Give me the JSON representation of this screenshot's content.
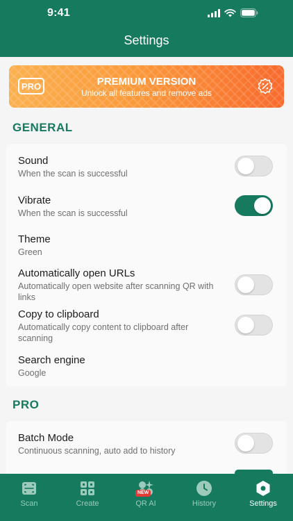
{
  "status_bar": {
    "time": "9:41"
  },
  "header": {
    "title": "Settings"
  },
  "premium": {
    "badge": "PRO",
    "title": "PREMIUM VERSION",
    "subtitle": "Unlock all features and remove ads"
  },
  "sections": {
    "general": "GENERAL",
    "pro": "PRO"
  },
  "general_items": [
    {
      "title": "Sound",
      "subtitle": "When the scan is successful",
      "toggle": "off"
    },
    {
      "title": "Vibrate",
      "subtitle": "When the scan is successful",
      "toggle": "on"
    },
    {
      "title": "Theme",
      "subtitle": "Green"
    },
    {
      "title": "Automatically open URLs",
      "subtitle": "Automatically open website after scanning QR with links",
      "toggle": "off"
    },
    {
      "title": "Copy to clipboard",
      "subtitle": "Automatically copy content to clipboard after scanning",
      "toggle": "off"
    },
    {
      "title": "Search engine",
      "subtitle": "Google"
    }
  ],
  "pro_items": [
    {
      "title": "Batch Mode",
      "subtitle": "Continuous scanning, auto add to history",
      "toggle": "off"
    }
  ],
  "tabbar": {
    "items": [
      {
        "label": "Scan",
        "icon": "scan-icon"
      },
      {
        "label": "Create",
        "icon": "create-icon"
      },
      {
        "label": "QR AI",
        "icon": "qr-ai-icon",
        "badge": "NEW"
      },
      {
        "label": "History",
        "icon": "clock-icon"
      },
      {
        "label": "Settings",
        "icon": "settings-hexagon-icon",
        "active": true
      }
    ]
  },
  "colors": {
    "primary": "#167a5e",
    "accent_orange": "#fb9a3b",
    "badge_red": "#e53935"
  }
}
